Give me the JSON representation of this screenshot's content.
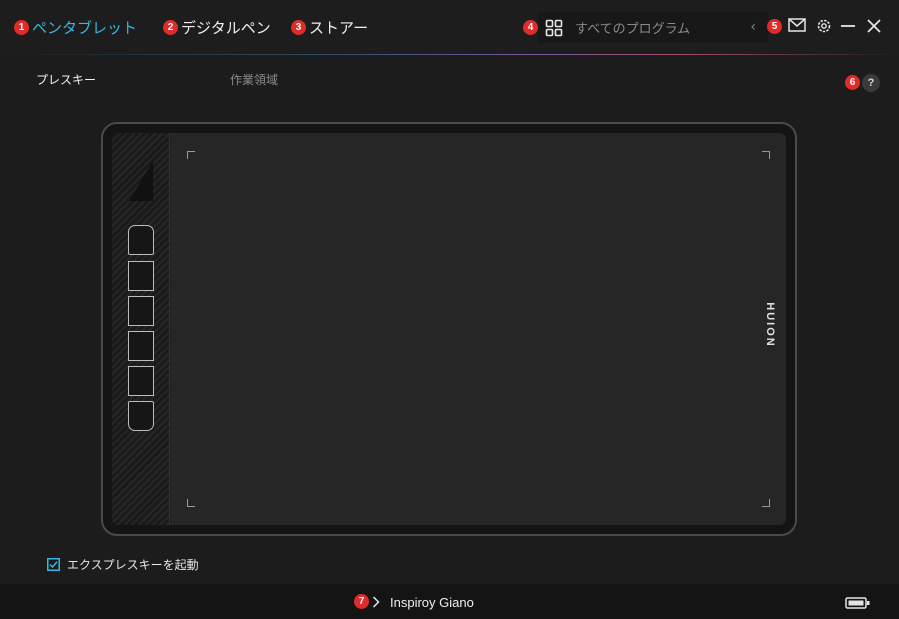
{
  "tabs": [
    {
      "number": "1",
      "label": "ペンタブレット"
    },
    {
      "number": "2",
      "label": "デジタルペン"
    },
    {
      "number": "3",
      "label": "ストアー"
    }
  ],
  "apps": {
    "number": "4",
    "label": "すべてのプログラム",
    "back_glyph": "‹"
  },
  "window_controls": {
    "number": "5",
    "help_number": "6",
    "help_label": "?"
  },
  "sub_tabs": [
    {
      "label": "プレスキー"
    },
    {
      "label": "作業領域"
    }
  ],
  "tablet": {
    "brand": "HUION",
    "key_count": 6
  },
  "express_keys_toggle": {
    "label": "エクスプレスキーを起動",
    "checked": true
  },
  "status": {
    "number": "7",
    "device_name": "Inspiroy Giano"
  },
  "colors": {
    "accent": "#35b8e0",
    "badge": "#e02b2b",
    "background": "#1c1c1c"
  }
}
